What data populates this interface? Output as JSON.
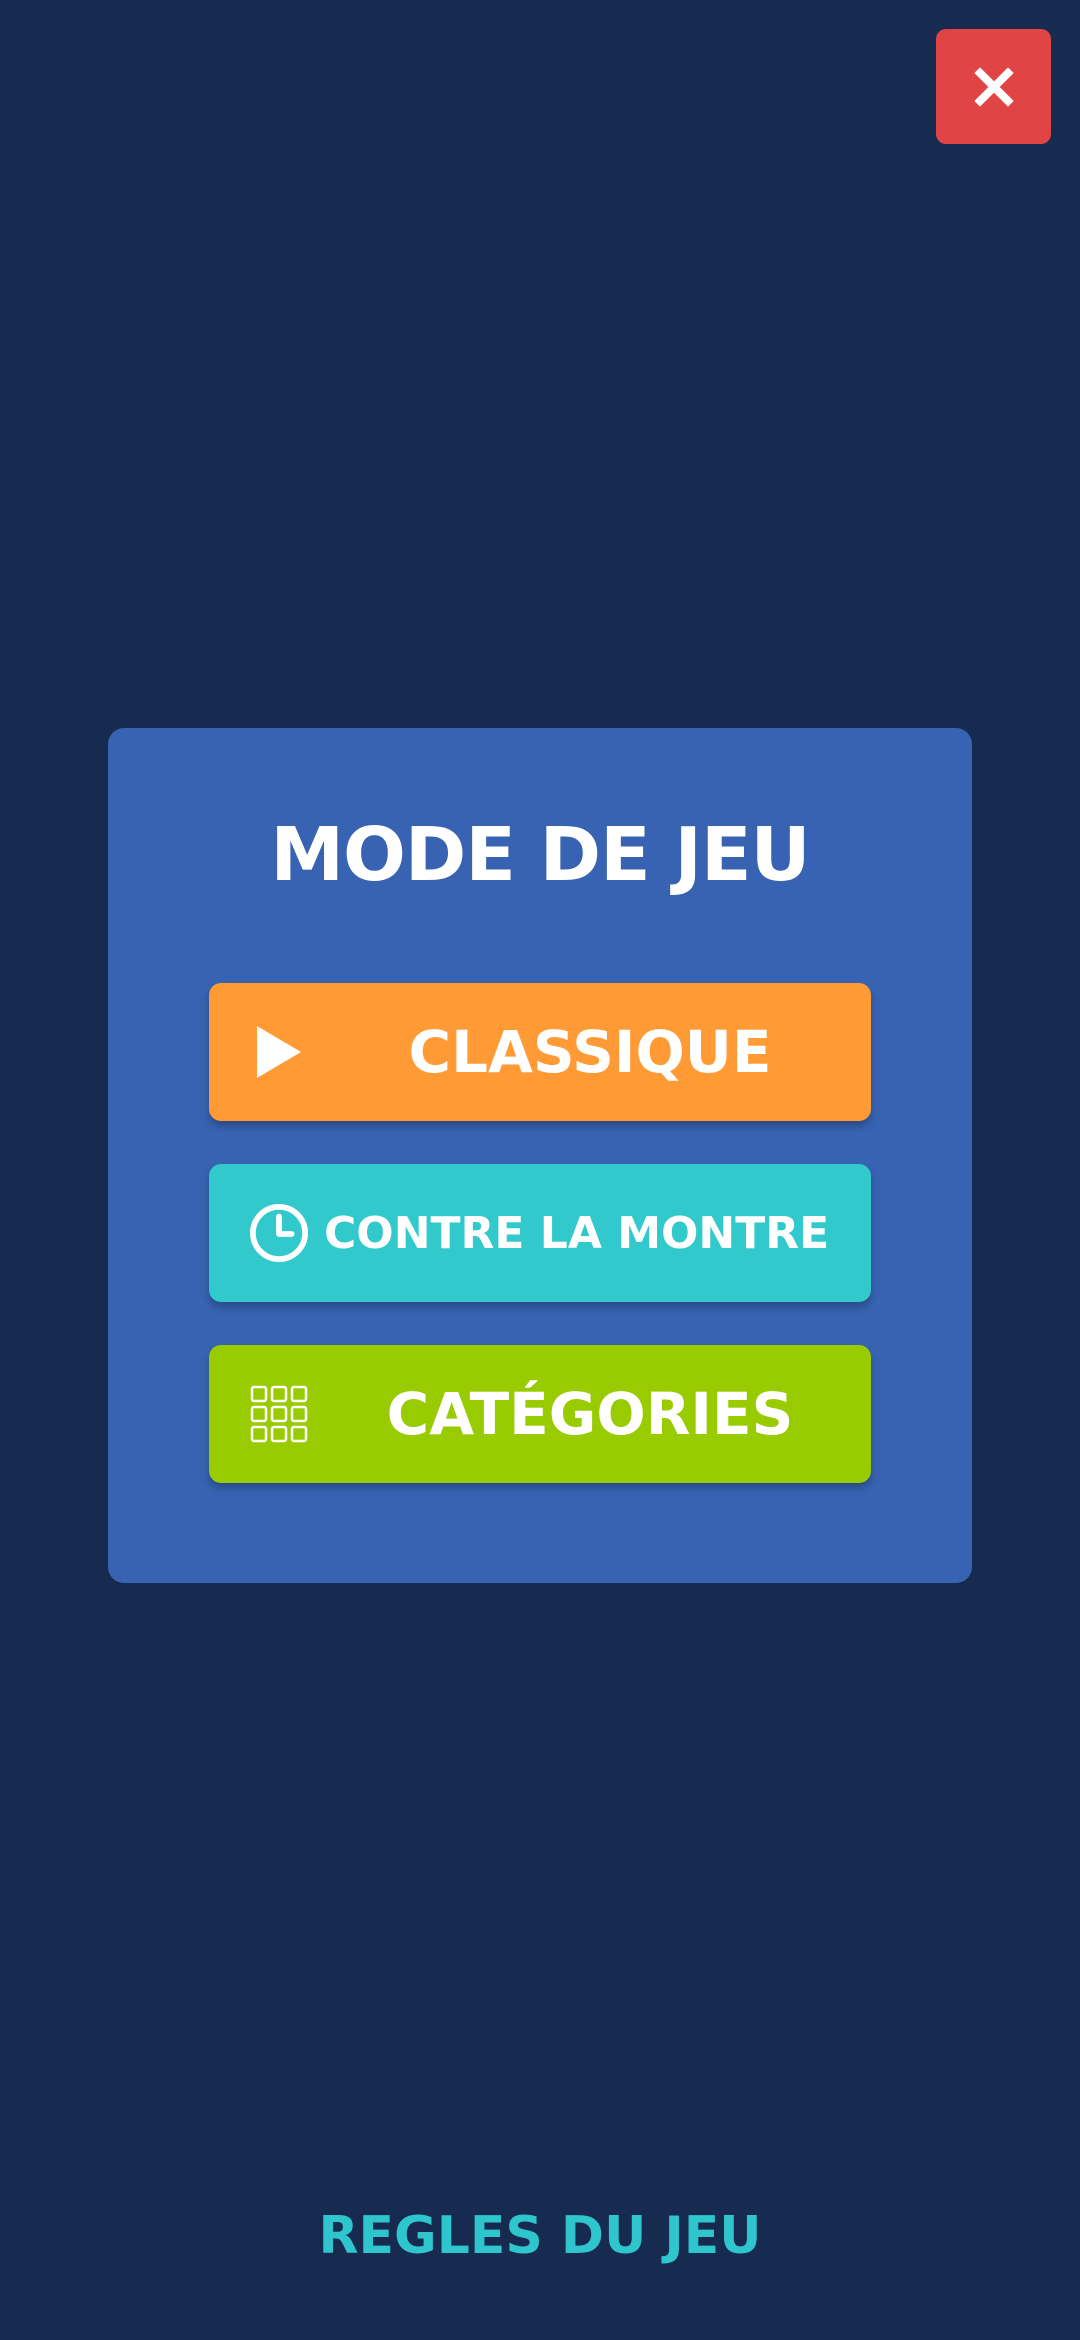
{
  "header": {
    "close_icon": "close-icon",
    "close_color": "#e04444"
  },
  "panel": {
    "title": "MODE DE JEU",
    "background": "#3763b2",
    "buttons": [
      {
        "label": "CLASSIQUE",
        "icon": "play-icon",
        "color": "#ff9a35"
      },
      {
        "label": "CONTRE LA MONTRE",
        "icon": "clock-icon",
        "color": "#31c9cb"
      },
      {
        "label": "CATÉGORIES",
        "icon": "grid-icon",
        "color": "#98cc00"
      }
    ]
  },
  "footer": {
    "rules_label": "REGLES DU JEU",
    "rules_color": "#2ec6cc"
  },
  "page_background": "#172a4f"
}
